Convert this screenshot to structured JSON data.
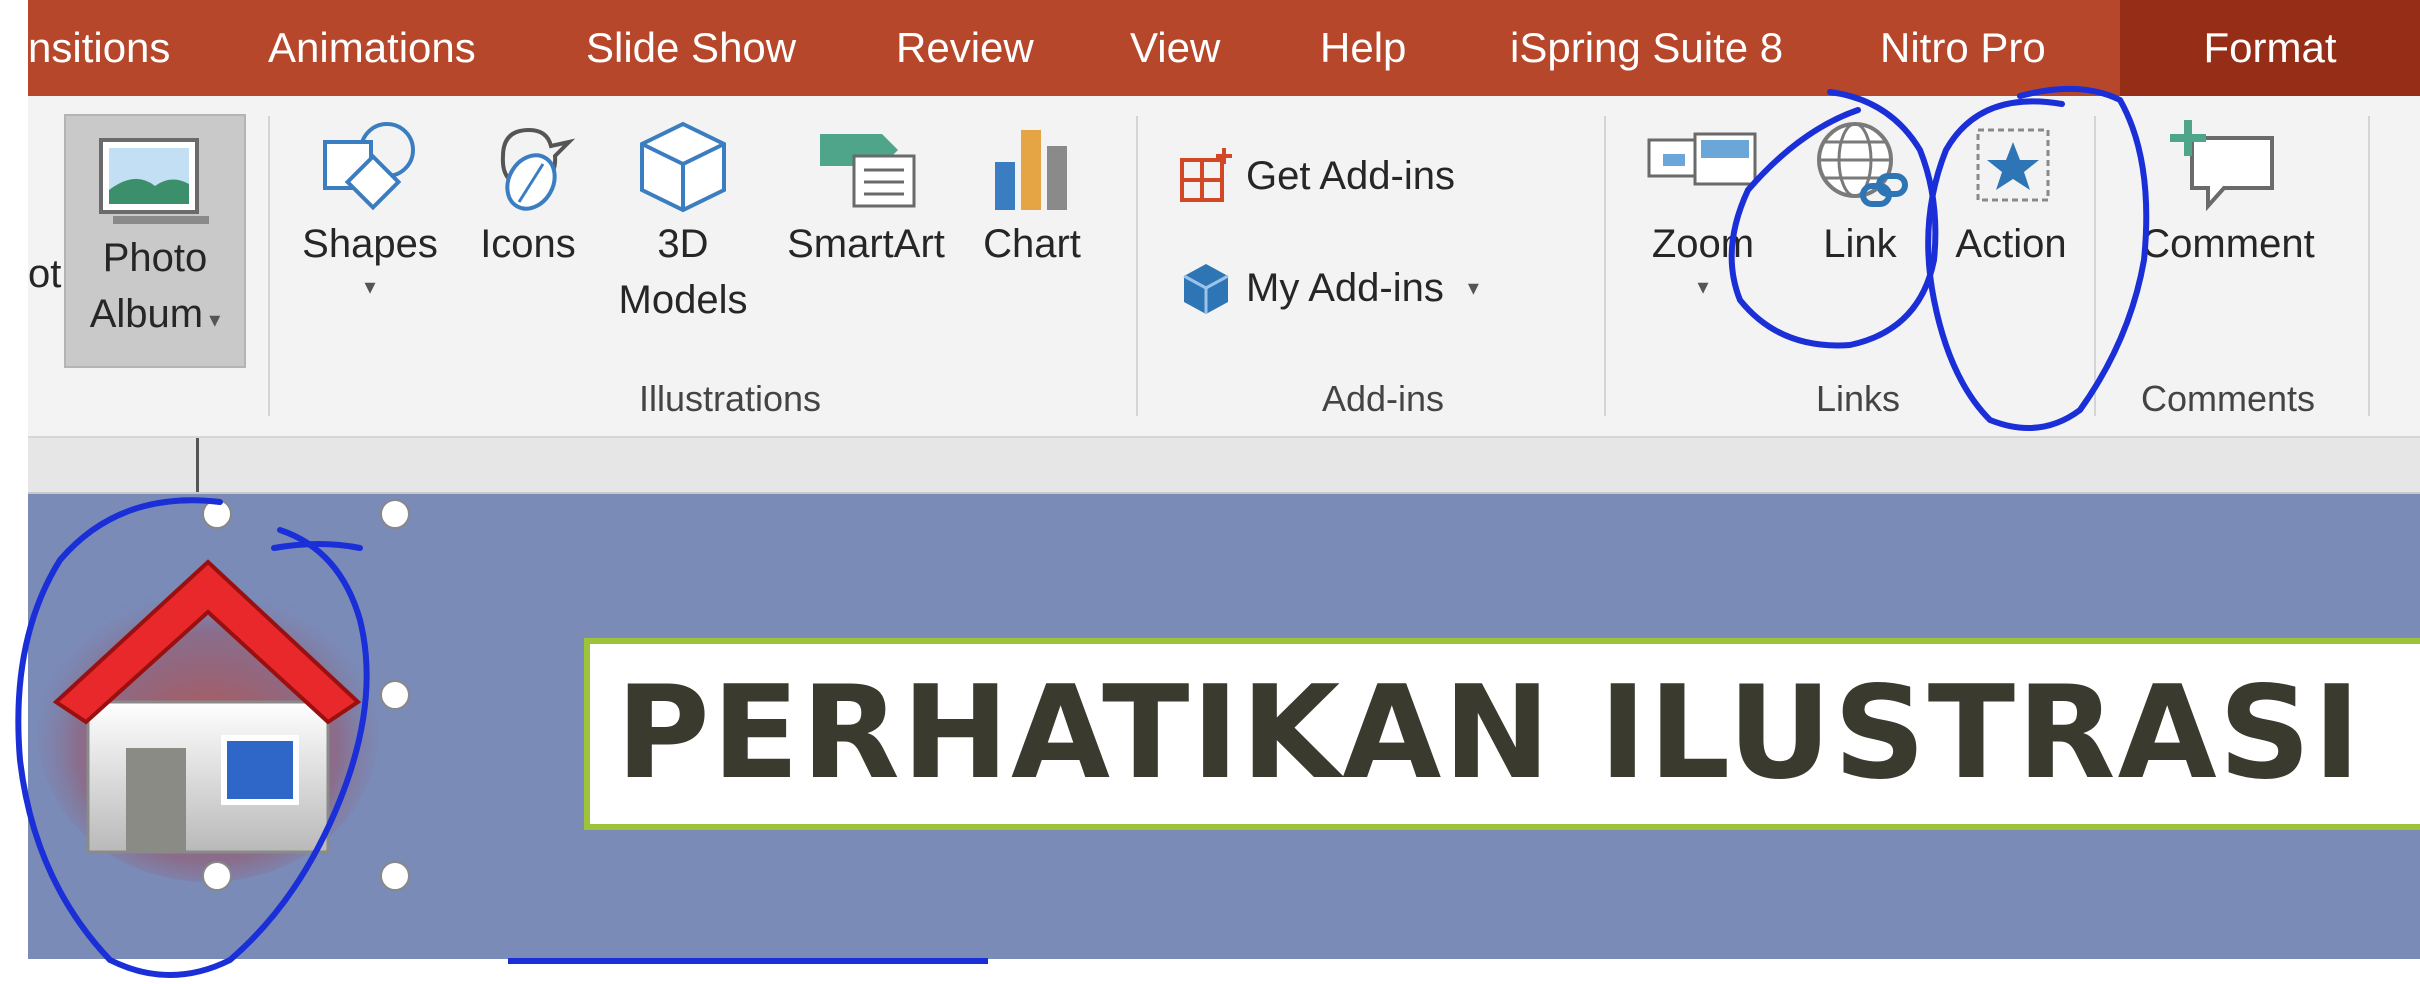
{
  "tabs": [
    {
      "label": "nsitions"
    },
    {
      "label": "Animations"
    },
    {
      "label": "Slide Show"
    },
    {
      "label": "Review"
    },
    {
      "label": "View"
    },
    {
      "label": "Help"
    },
    {
      "label": "iSpring Suite 8"
    },
    {
      "label": "Nitro Pro"
    },
    {
      "label": "Format",
      "active": true
    }
  ],
  "ribbon": {
    "partial_label": "ot",
    "photo_album": {
      "line1": "Photo",
      "line2": "Album"
    },
    "illustrations": {
      "shapes": "Shapes",
      "icons": "Icons",
      "models_line1": "3D",
      "models_line2": "Models",
      "smartart": "SmartArt",
      "chart": "Chart",
      "group_label": "Illustrations"
    },
    "addins": {
      "get": "Get Add-ins",
      "my": "My Add-ins",
      "group_label": "Add-ins"
    },
    "links": {
      "zoom": "Zoom",
      "link": "Link",
      "action": "Action",
      "group_label": "Links"
    },
    "comments": {
      "comment": "Comment",
      "group_label": "Comments"
    }
  },
  "slide": {
    "title": "PERHATIKAN ILUSTRASI D"
  },
  "colors": {
    "tab_bar": "#b7472a",
    "active_tab": "#952d17",
    "slide_bg": "#7a8bb8",
    "title_border": "#9dc33b",
    "ink": "#1a2fd8"
  }
}
